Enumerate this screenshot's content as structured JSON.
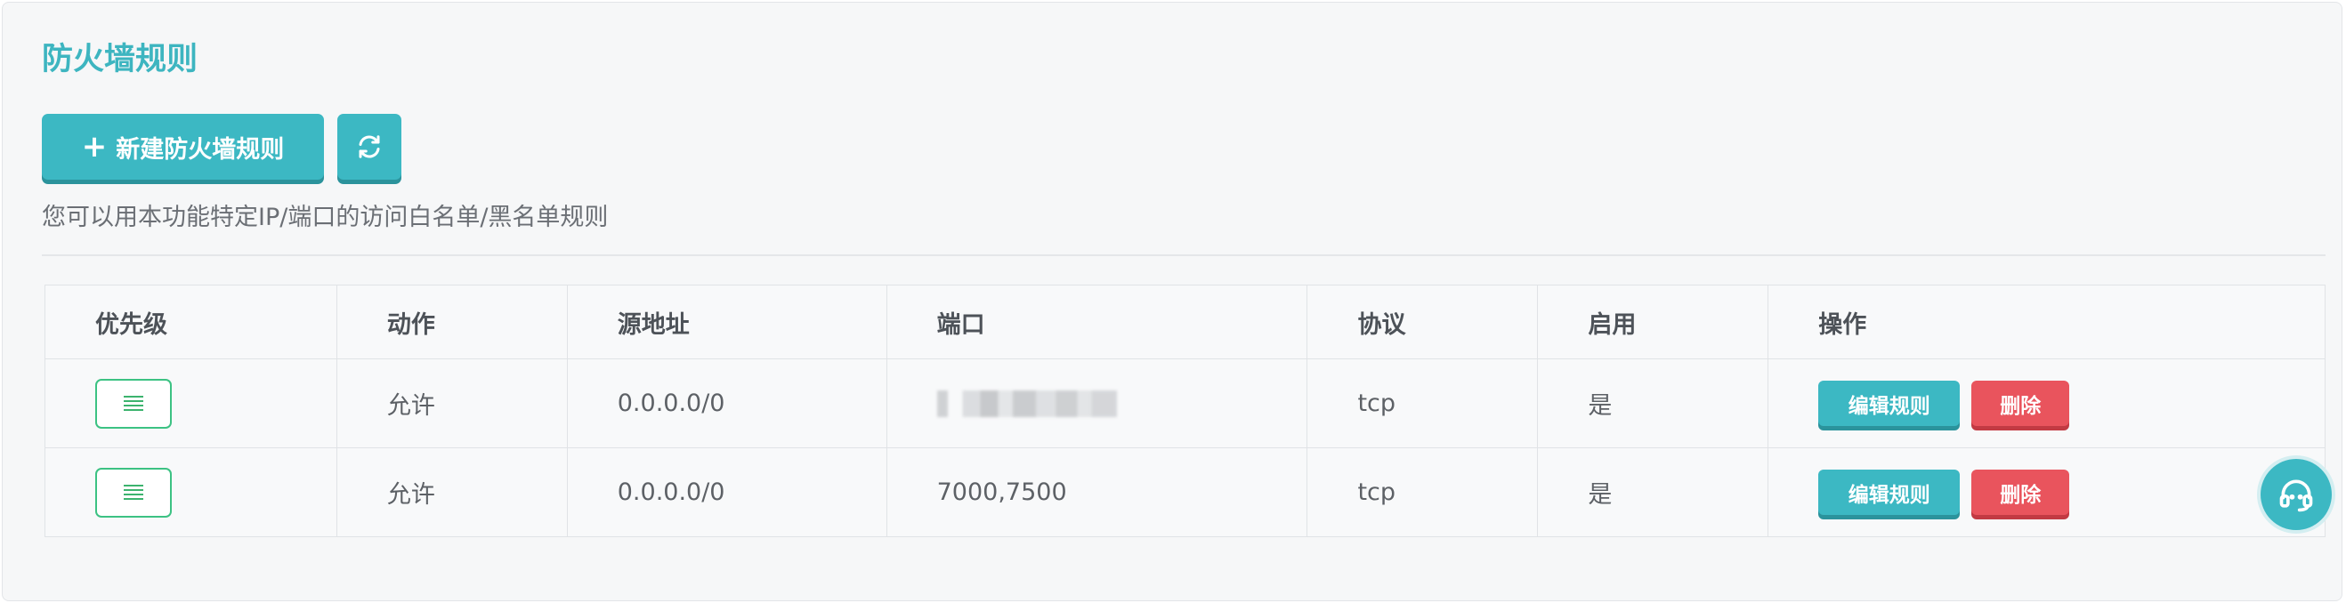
{
  "panel": {
    "title": "防火墙规则",
    "new_button_label": "新建防火墙规则",
    "description": "您可以用本功能特定IP/端口的访问白名单/黑名单规则"
  },
  "table": {
    "headers": [
      "优先级",
      "动作",
      "源地址",
      "端口",
      "协议",
      "启用",
      "操作"
    ],
    "rows": [
      {
        "action": "允许",
        "source": "0.0.0.0/0",
        "port": "",
        "protocol": "tcp",
        "enabled": "是",
        "edit_label": "编辑规则",
        "delete_label": "删除"
      },
      {
        "action": "允许",
        "source": "0.0.0.0/0",
        "port": "7000,7500",
        "protocol": "tcp",
        "enabled": "是",
        "edit_label": "编辑规则",
        "delete_label": "删除"
      }
    ]
  },
  "icons": {
    "plus": "plus-icon",
    "refresh": "refresh-icon",
    "drag": "drag-handle-icon",
    "support": "headset-support-icon"
  },
  "colors": {
    "accent": "#3cb8c3",
    "danger": "#e9545d",
    "success_border": "#3cc283",
    "title": "#3db5c0"
  }
}
